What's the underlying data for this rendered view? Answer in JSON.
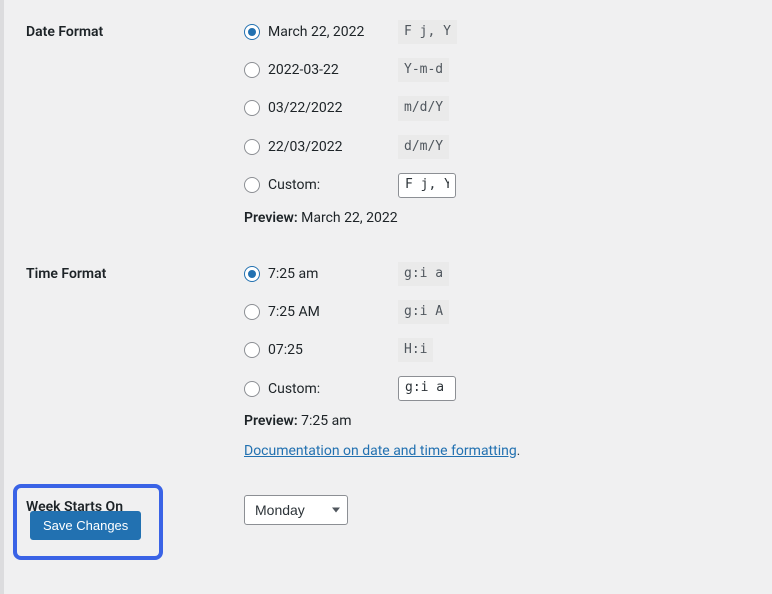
{
  "dateFormat": {
    "label": "Date Format",
    "options": [
      {
        "label": "March 22, 2022",
        "code": "F j, Y",
        "checked": true
      },
      {
        "label": "2022-03-22",
        "code": "Y-m-d",
        "checked": false
      },
      {
        "label": "03/22/2022",
        "code": "m/d/Y",
        "checked": false
      },
      {
        "label": "22/03/2022",
        "code": "d/m/Y",
        "checked": false
      }
    ],
    "customLabel": "Custom:",
    "customValue": "F j, Y",
    "previewLabel": "Preview:",
    "previewValue": "March 22, 2022"
  },
  "timeFormat": {
    "label": "Time Format",
    "options": [
      {
        "label": "7:25 am",
        "code": "g:i a",
        "checked": true
      },
      {
        "label": "7:25 AM",
        "code": "g:i A",
        "checked": false
      },
      {
        "label": "07:25",
        "code": "H:i",
        "checked": false
      }
    ],
    "customLabel": "Custom:",
    "customValue": "g:i a",
    "previewLabel": "Preview:",
    "previewValue": "7:25 am",
    "docsLink": "Documentation on date and time formatting",
    "docsPeriod": "."
  },
  "weekStart": {
    "label": "Week Starts On",
    "value": "Monday"
  },
  "saveLabel": "Save Changes"
}
